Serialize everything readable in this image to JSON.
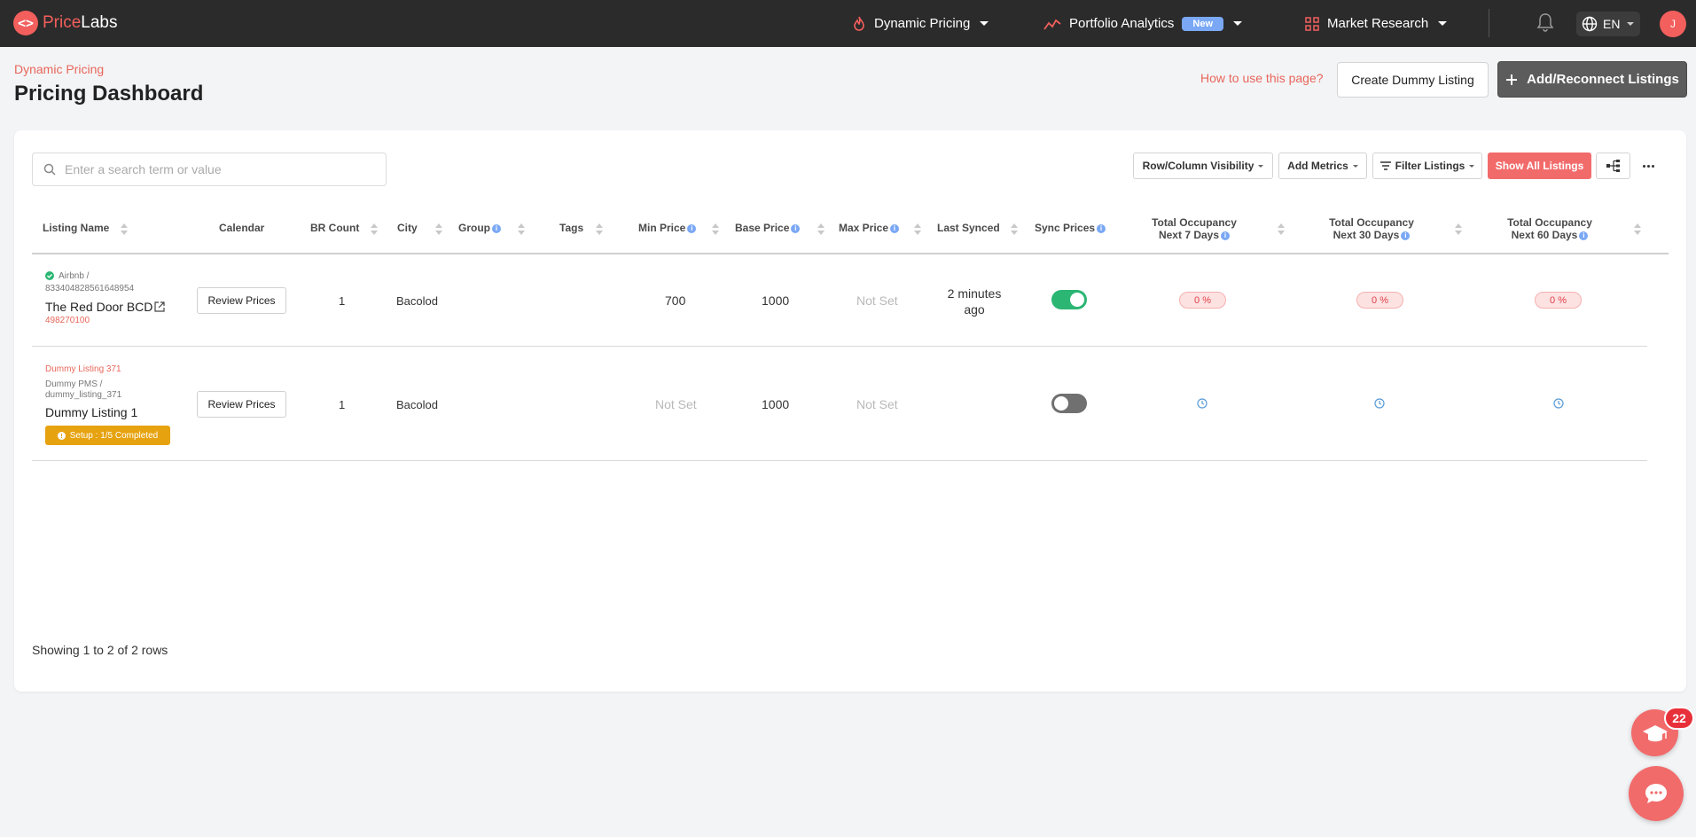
{
  "app": {
    "logo_glyph": "<>",
    "logo_prefix": "Price",
    "logo_suffix": "Labs"
  },
  "nav": {
    "dynamic_pricing": "Dynamic Pricing",
    "portfolio_analytics": "Portfolio Analytics",
    "portfolio_badge": "New",
    "market_research": "Market Research",
    "language": "EN",
    "user_initial": "J"
  },
  "header": {
    "breadcrumb": "Dynamic Pricing",
    "title": "Pricing Dashboard",
    "how_to": "How to use this page?",
    "create_dummy": "Create Dummy Listing",
    "add_reconnect": "Add/Reconnect Listings"
  },
  "toolbar": {
    "search_placeholder": "Enter a search term or value",
    "row_column_visibility": "Row/Column Visibility",
    "add_metrics": "Add Metrics",
    "filter_listings": "Filter Listings",
    "show_all_listings": "Show All Listings"
  },
  "table": {
    "columns": {
      "listing_name": "Listing Name",
      "calendar": "Calendar",
      "br_count": "BR Count",
      "city": "City",
      "group": "Group",
      "tags": "Tags",
      "min_price": "Min Price",
      "base_price": "Base Price",
      "max_price": "Max Price",
      "last_synced": "Last Synced",
      "sync_prices": "Sync Prices",
      "occ7_line1": "Total Occupancy",
      "occ7_line2": "Next 7 Days",
      "occ30_line1": "Total Occupancy",
      "occ30_line2": "Next 30 Days",
      "occ60_line1": "Total Occupancy",
      "occ60_line2": "Next 60 Days"
    },
    "rows": [
      {
        "source_line1": "Airbnb /",
        "source_line2": "833404828561648954",
        "name": "The Red Door BCD",
        "listing_id": "498270100",
        "review_label": "Review Prices",
        "br_count": "1",
        "city": "Bacolod",
        "min_price": "700",
        "base_price": "1000",
        "max_price": "Not Set",
        "last_synced_1": "2 minutes",
        "last_synced_2": "ago",
        "sync_on": true,
        "occ7": "0 %",
        "occ30": "0 %",
        "occ60": "0 %"
      },
      {
        "dummy_tag": "Dummy Listing 371",
        "source_line1": "Dummy PMS /",
        "source_line2": "dummy_listing_371",
        "name": "Dummy Listing 1",
        "setup_label": "Setup : 1/5 Completed",
        "review_label": "Review Prices",
        "br_count": "1",
        "city": "Bacolod",
        "min_price": "Not Set",
        "base_price": "1000",
        "max_price": "Not Set",
        "sync_on": false
      }
    ],
    "footer": "Showing 1 to 2 of 2 rows"
  },
  "fab": {
    "notification_count": "22"
  },
  "colors": {
    "brand": "#f25f5c",
    "topbar": "#2b2b2b",
    "toggle_on": "#2bb673",
    "toggle_off": "#707070",
    "info": "#7aa8f5"
  },
  "icons": [
    "search-icon",
    "fire-icon",
    "analytics-icon",
    "grid-icon",
    "bell-icon",
    "globe-icon",
    "plus-icon",
    "filter-icon",
    "hierarchy-icon",
    "more-icon",
    "check-circle-icon",
    "external-link-icon",
    "clock-icon",
    "graduation-cap-icon",
    "chat-icon"
  ]
}
